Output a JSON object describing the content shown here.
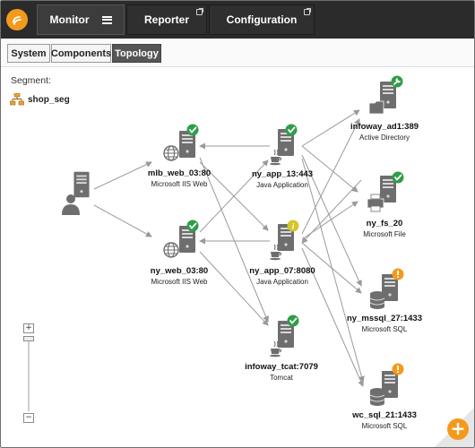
{
  "app": {
    "logo_icon": "app-logo-icon",
    "accent_color": "#f39a1e"
  },
  "nav": {
    "monitor": "Monitor",
    "reporter": "Reporter",
    "configuration": "Configuration"
  },
  "subtabs": {
    "system": "System",
    "components": "Components",
    "topology": "Topology",
    "active": "Topology"
  },
  "segment": {
    "label": "Segment:",
    "name": "shop_seg"
  },
  "nodes": [
    {
      "id": "client",
      "name": "",
      "type": "",
      "icon": "user-server-icon",
      "status": ""
    },
    {
      "id": "mlb_web_03",
      "name": "mlb_web_03:80",
      "type": "Microsoft IIS Web",
      "icon": "iis-web-server-icon",
      "status": "ok"
    },
    {
      "id": "ny_web_03",
      "name": "ny_web_03:80",
      "type": "Microsoft IIS Web",
      "icon": "iis-web-server-icon",
      "status": "ok"
    },
    {
      "id": "ny_app_13",
      "name": "ny_app_13:443",
      "type": "Java Application",
      "icon": "java-server-icon",
      "status": "ok"
    },
    {
      "id": "ny_app_07",
      "name": "ny_app_07:8080",
      "type": "Java Application",
      "icon": "java-server-icon",
      "status": "info"
    },
    {
      "id": "infoway_tcat",
      "name": "infoway_tcat:7079",
      "type": "Tomcat",
      "icon": "java-server-icon",
      "status": "ok"
    },
    {
      "id": "infoway_ad1",
      "name": "infoway_ad1:389",
      "type": "Active Directory",
      "icon": "directory-server-icon",
      "status": "maintenance"
    },
    {
      "id": "ny_fs_20",
      "name": "ny_fs_20",
      "type": "Microsoft File",
      "icon": "file-server-icon",
      "status": "ok"
    },
    {
      "id": "ny_mssql_27",
      "name": "ny_mssql_27:1433",
      "type": "Microsoft SQL",
      "icon": "sql-server-icon",
      "status": "warning"
    },
    {
      "id": "wc_sql_21",
      "name": "wc_sql_21:1433",
      "type": "Microsoft SQL",
      "icon": "sql-server-icon",
      "status": "warning"
    }
  ],
  "status_colors": {
    "ok": "#2e9e48",
    "info": "#d4c62a",
    "warning": "#f39a1e",
    "maintenance": "#2e9e48"
  },
  "zoom": {
    "in": "+",
    "out": "−",
    "level": 0.95
  },
  "fab": {
    "label": "+"
  }
}
